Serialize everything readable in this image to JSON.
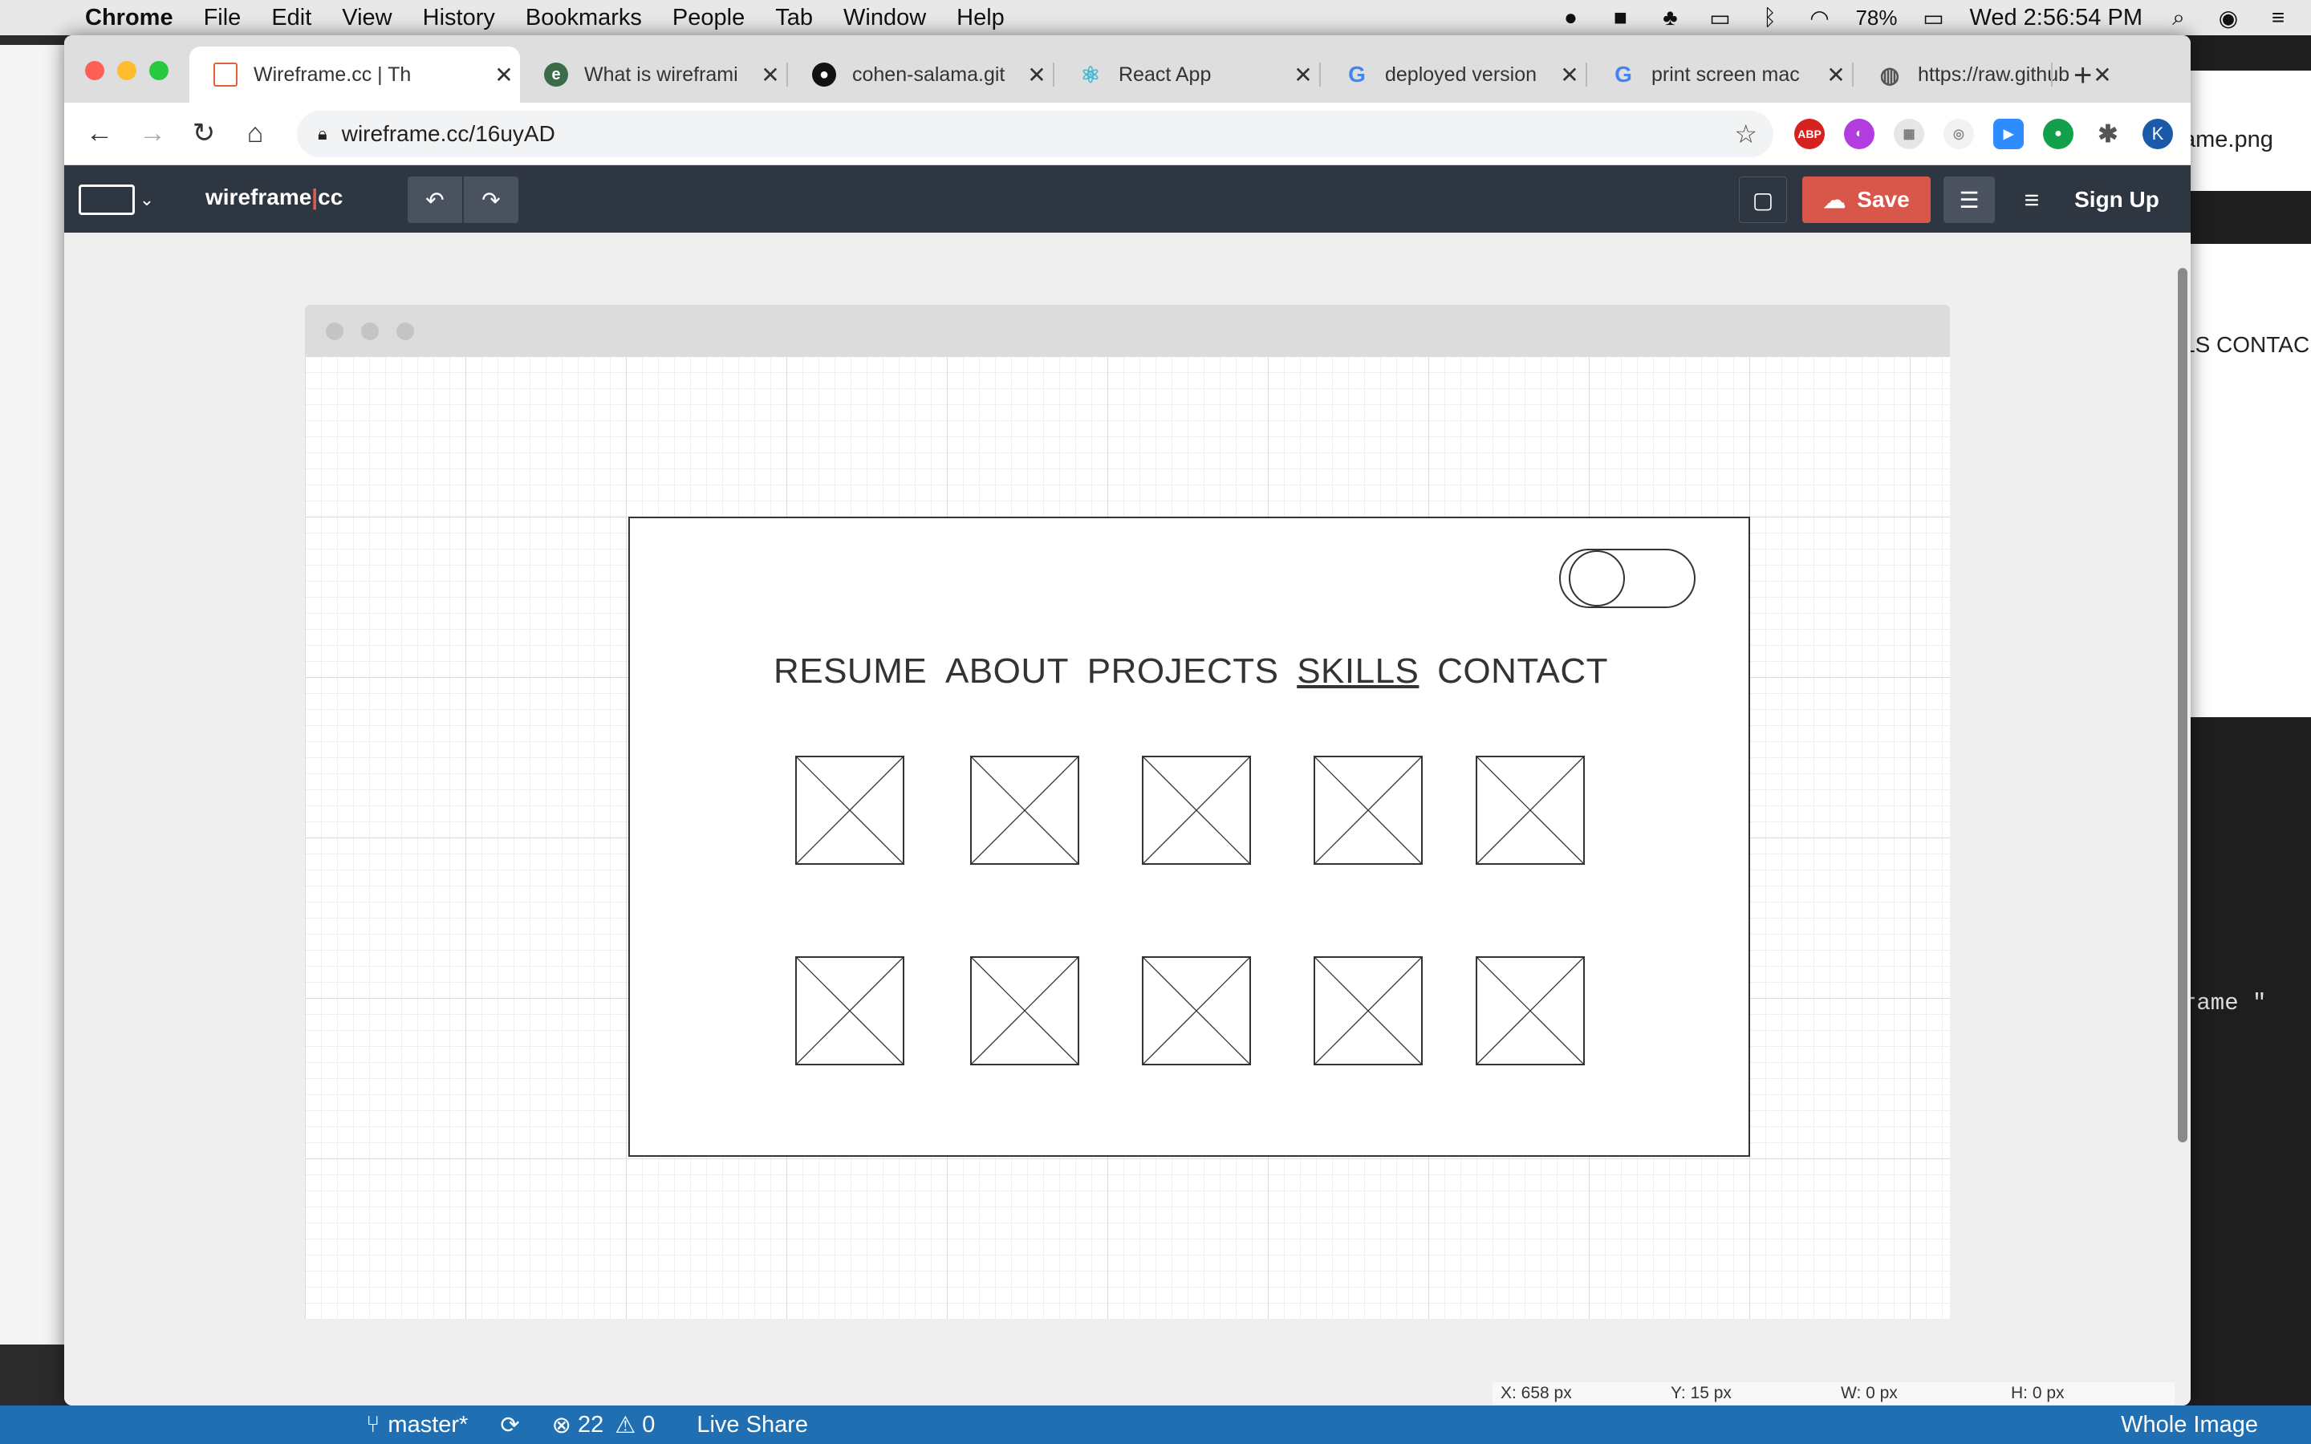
{
  "menubar": {
    "app": "Chrome",
    "items": [
      "File",
      "Edit",
      "View",
      "History",
      "Bookmarks",
      "People",
      "Tab",
      "Window",
      "Help"
    ],
    "battery": "78%",
    "clock": "Wed 2:56:54 PM"
  },
  "chrome": {
    "tabs": [
      {
        "title": "Wireframe.cc | Th",
        "favicon": "wireframe-favicon",
        "color": "#e0613c"
      },
      {
        "title": "What is wireframi",
        "favicon": "eduonix-favicon",
        "color": "#3c6b4a"
      },
      {
        "title": "cohen-salama.git",
        "favicon": "github-favicon",
        "color": "#111111"
      },
      {
        "title": "React App",
        "favicon": "react-favicon",
        "color": "#41b9d6"
      },
      {
        "title": "deployed version",
        "favicon": "google-favicon",
        "color": "#4285f4"
      },
      {
        "title": "print screen mac",
        "favicon": "google-favicon",
        "color": "#4285f4"
      },
      {
        "title": "https://raw.github",
        "favicon": "globe-favicon",
        "color": "#555555"
      }
    ],
    "url": "wireframe.cc/16uyAD",
    "profile_initial": "K"
  },
  "app": {
    "logo_main": "wireframe",
    "logo_suffix": "cc",
    "save_label": "Save",
    "signup_label": "Sign Up"
  },
  "wireframe": {
    "nav_items": [
      "RESUME",
      "ABOUT",
      "PROJECTS",
      "SKILLS",
      "CONTACT"
    ],
    "underlined_item": "SKILLS",
    "image_rows": 2,
    "images_per_row": 5
  },
  "coords": {
    "x": "X: 658 px",
    "y": "Y: 15 px",
    "w": "W: 0 px",
    "h": "H: 0 px"
  },
  "background": {
    "right_frag_1": "ame.png",
    "right_frag_2": "LS CONTAC",
    "right_frag_3": "rame \""
  },
  "statusbar": {
    "branch": "master*",
    "errors": "22",
    "warnings": "0",
    "live_share": "Live Share",
    "right_label": "Whole Image"
  }
}
